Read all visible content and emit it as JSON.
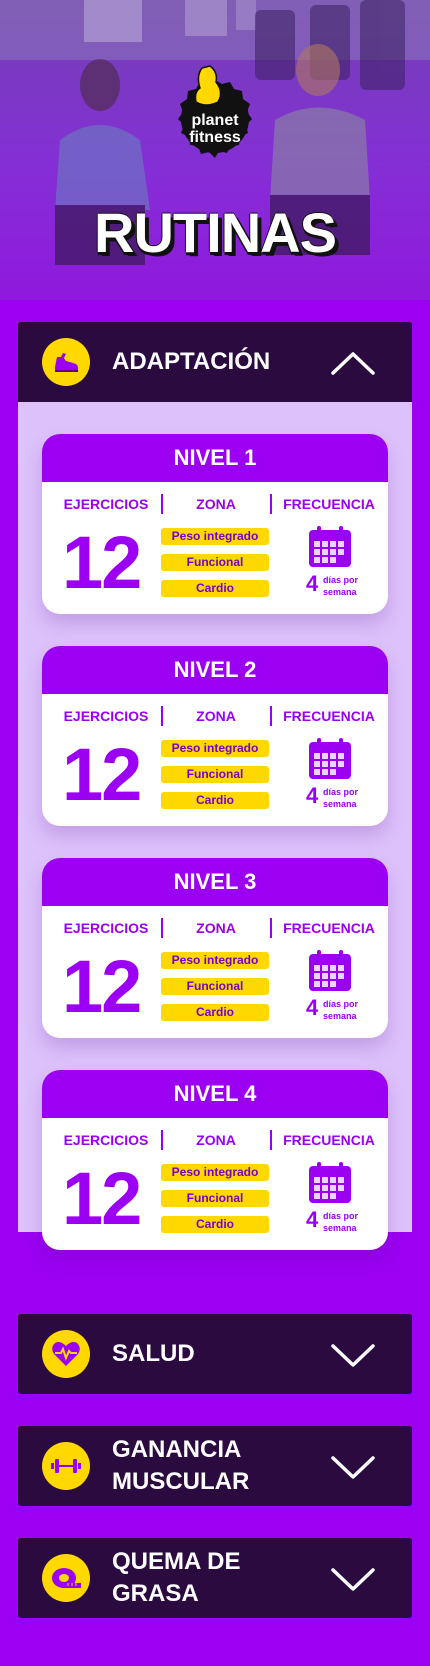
{
  "hero": {
    "logo_line1": "planet",
    "logo_line2": "fitness",
    "title": "RUTINAS"
  },
  "colors": {
    "primary": "#9b00f2",
    "dark": "#2b0a40",
    "accent": "#ffd800",
    "panel": "#ddc1fb"
  },
  "sections": [
    {
      "label": "ADAPTACIÓN",
      "icon": "sneaker-icon",
      "expanded": true,
      "columns": [
        "EJERCICIOS",
        "ZONA",
        "FRECUENCIA"
      ],
      "levels": [
        {
          "title": "NIVEL 1",
          "exercises": "12",
          "zones": [
            "Peso integrado",
            "Funcional",
            "Cardio"
          ],
          "days": "4",
          "days_text": "días por semana"
        },
        {
          "title": "NIVEL 2",
          "exercises": "12",
          "zones": [
            "Peso integrado",
            "Funcional",
            "Cardio"
          ],
          "days": "4",
          "days_text": "días por semana"
        },
        {
          "title": "NIVEL 3",
          "exercises": "12",
          "zones": [
            "Peso integrado",
            "Funcional",
            "Cardio"
          ],
          "days": "4",
          "days_text": "días por semana"
        },
        {
          "title": "NIVEL 4",
          "exercises": "12",
          "zones": [
            "Peso integrado",
            "Funcional",
            "Cardio"
          ],
          "days": "4",
          "days_text": "días por semana"
        }
      ]
    },
    {
      "label": "SALUD",
      "icon": "heart-pulse-icon",
      "expanded": false
    },
    {
      "label_line1": "GANANCIA",
      "label_line2": "MUSCULAR",
      "icon": "dumbbell-icon",
      "expanded": false
    },
    {
      "label_line1": "QUEMA DE",
      "label_line2": "GRASA",
      "icon": "measuring-tape-icon",
      "expanded": false
    }
  ]
}
